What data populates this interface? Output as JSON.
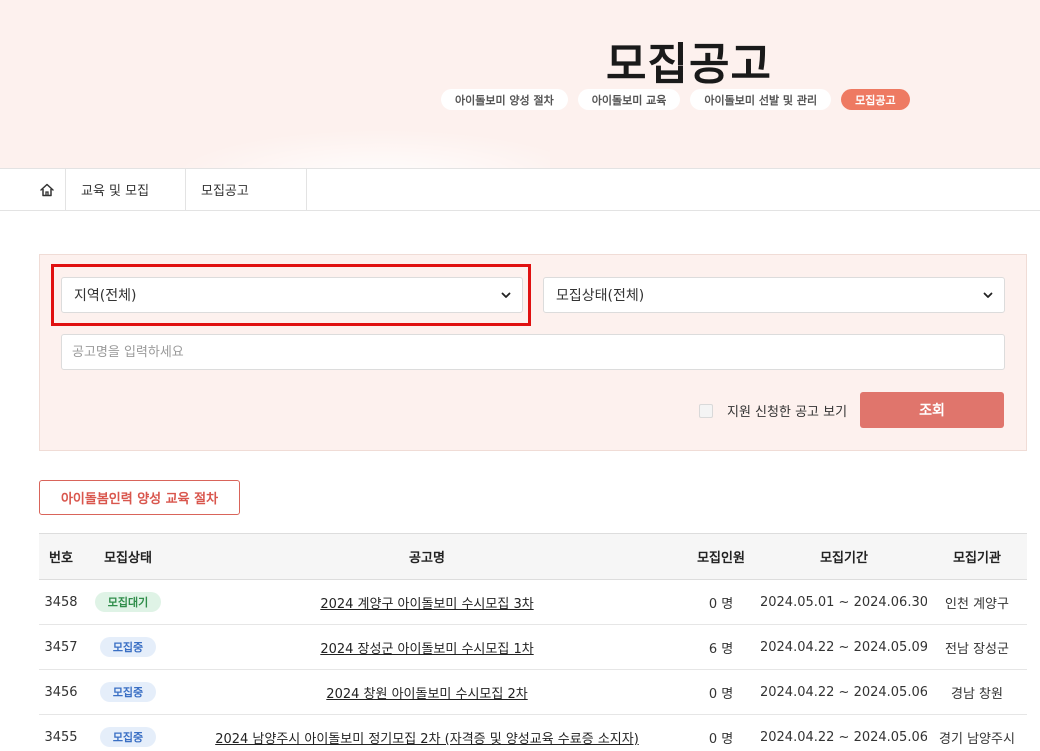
{
  "hero": {
    "title": "모집공고",
    "tabs": [
      {
        "label": "아이돌보미 양성 절차",
        "active": false
      },
      {
        "label": "아이돌보미 교육",
        "active": false
      },
      {
        "label": "아이돌보미 선발 및 관리",
        "active": false
      },
      {
        "label": "모집공고",
        "active": true
      }
    ]
  },
  "breadcrumb": {
    "home_icon": "home-icon",
    "items": [
      "교육 및 모집",
      "모집공고"
    ]
  },
  "search": {
    "region_select": "지역(전체)",
    "status_select": "모집상태(전체)",
    "title_placeholder": "공고명을 입력하세요",
    "checkbox_label": "지원 신청한 공고 보기",
    "search_button": "조회"
  },
  "procedure_button": "아이돌봄인력 양성 교육 절차",
  "table": {
    "headers": [
      "번호",
      "모집상태",
      "공고명",
      "모집인원",
      "모집기간",
      "모집기관"
    ],
    "rows": [
      {
        "no": "3458",
        "status": "모집대기",
        "status_type": "wait",
        "title": "2024 계양구 아이돌보미 수시모집 3차",
        "count": "0 명",
        "period": "2024.05.01 ~ 2024.06.30",
        "org": "인천 계양구"
      },
      {
        "no": "3457",
        "status": "모집중",
        "status_type": "open",
        "title": "2024 장성군 아이돌보미 수시모집 1차",
        "count": "6 명",
        "period": "2024.04.22 ~ 2024.05.09",
        "org": "전남 장성군"
      },
      {
        "no": "3456",
        "status": "모집중",
        "status_type": "open",
        "title": "2024 창원 아이돌보미 수시모집 2차",
        "count": "0 명",
        "period": "2024.04.22 ~ 2024.05.06",
        "org": "경남 창원"
      },
      {
        "no": "3455",
        "status": "모집중",
        "status_type": "open",
        "title": "2024 남양주시 아이돌보미 정기모집 2차 (자격증 및 양성교육 수료증 소지자)",
        "count": "0 명",
        "period": "2024.04.22 ~ 2024.05.06",
        "org": "경기 남양주시"
      }
    ]
  },
  "colors": {
    "hero_bg": "#fdf1ee",
    "accent": "#ee7a62",
    "search_button": "#e0756c",
    "highlight": "#e01010",
    "badge_wait": "#2f8d4a",
    "badge_open": "#3a6fc4"
  }
}
